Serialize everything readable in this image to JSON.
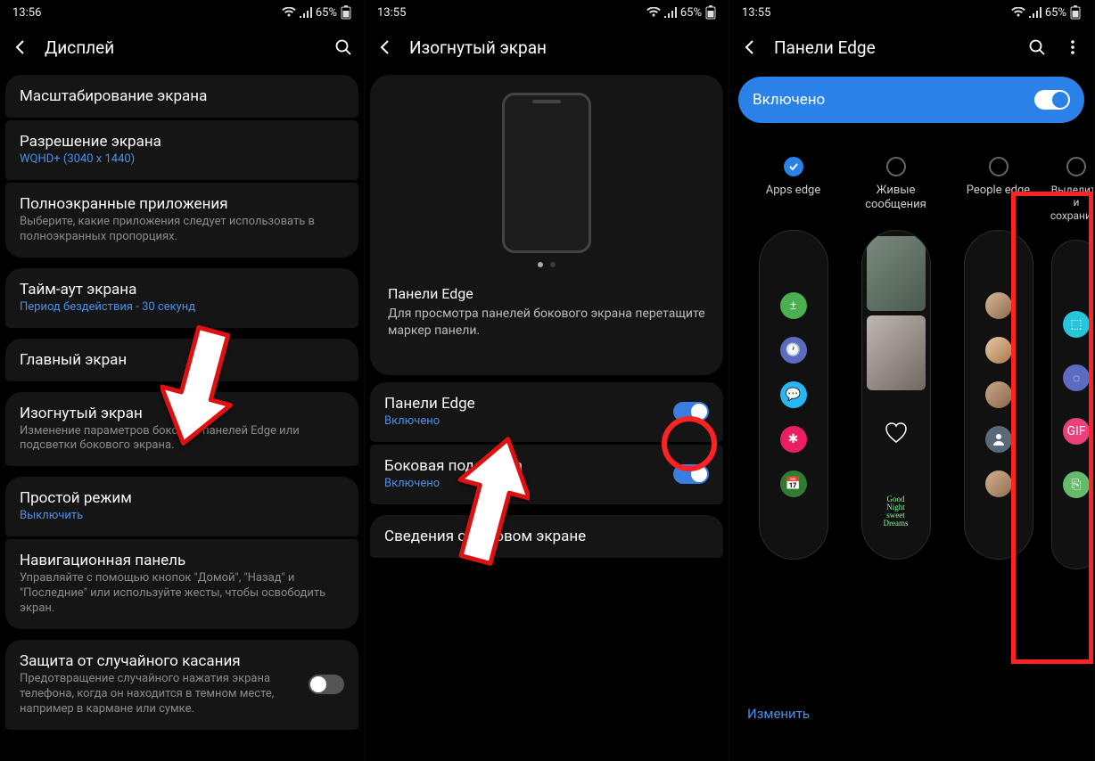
{
  "statusbar": {
    "time1": "13:56",
    "time2": "13:55",
    "time3": "13:55",
    "battery": "65%"
  },
  "screen1": {
    "title": "Дисплей",
    "items": {
      "scale": {
        "title": "Масштабирование экрана"
      },
      "resolution": {
        "title": "Разрешение экрана",
        "sub": "WQHD+ (3040 x 1440)"
      },
      "fullscreen": {
        "title": "Полноэкранные приложения",
        "sub": "Выберите, какие приложения следует использовать в полноэкранных пропорциях."
      },
      "timeout": {
        "title": "Тайм-аут экрана",
        "sub": "Период бездействия - 30 секунд"
      },
      "home": {
        "title": "Главный экран"
      },
      "edge": {
        "title": "Изогнутый экран",
        "sub": "Изменение параметров боковых панелей Edge или подсветки бокового экрана."
      },
      "easy": {
        "title": "Простой режим",
        "sub": "Выключить"
      },
      "nav": {
        "title": "Навигационная панель",
        "sub": "Управляйте с помощью кнопок \"Домой\", \"Назад\" и \"Последние\" или используйте жесты, чтобы освободить экран."
      },
      "accidental": {
        "title": "Защита от случайного касания",
        "sub": "Предотвращение случайного нажатия экрана телефона, когда он находится в темном месте, например в кармане или сумке."
      }
    }
  },
  "screen2": {
    "title": "Изогнутый экран",
    "preview": {
      "heading": "Панели Edge",
      "desc": "Для просмотра панелей бокового экрана перетащите маркер панели."
    },
    "panels": {
      "title": "Панели Edge",
      "sub": "Включено"
    },
    "lighting": {
      "title": "Боковая подсветка",
      "sub": "Включено"
    },
    "info": {
      "title": "Сведения о боковом экране"
    }
  },
  "screen3": {
    "title": "Панели Edge",
    "enabled": "Включено",
    "edit": "Изменить",
    "cols": [
      {
        "label": "Apps edge",
        "checked": true
      },
      {
        "label": "Живые сообщения",
        "checked": false
      },
      {
        "label": "People edge",
        "checked": false
      },
      {
        "label": "Выделить и сохранить",
        "checked": false
      }
    ]
  }
}
